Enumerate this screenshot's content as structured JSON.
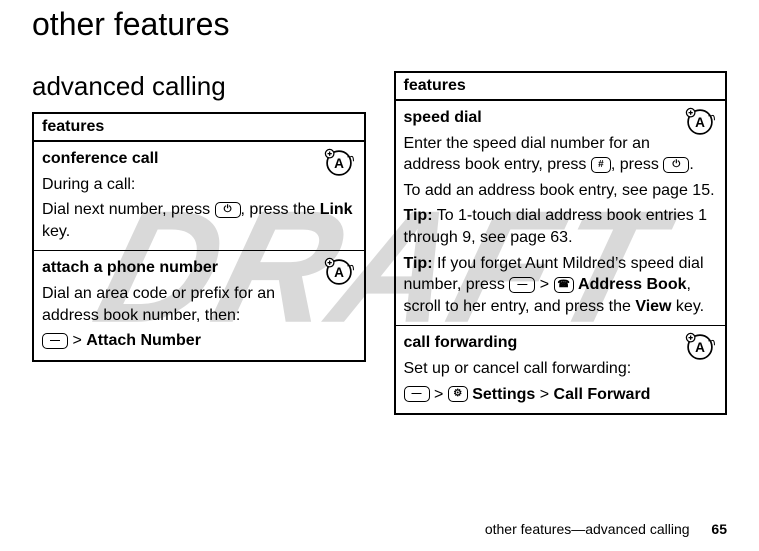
{
  "watermark": "DRAFT",
  "page_title": "other features",
  "section_title": "advanced calling",
  "left_table": {
    "header": "features",
    "rows": [
      {
        "title": "conference call",
        "line1": "During a call:",
        "line2a": "Dial next number, press ",
        "icon1": "send-icon",
        "line2b": ", press the ",
        "line2c": "Link",
        "line2d": " key."
      },
      {
        "title": "attach a phone number",
        "line1": "Dial an area code or prefix for an address book number, then:",
        "path_a": " > ",
        "path_b": "Attach Number"
      }
    ]
  },
  "right_table": {
    "header": "features",
    "rows": [
      {
        "title": "speed dial",
        "p1a": "Enter the speed dial number for an address book entry, press ",
        "key1": "#",
        "p1b": ", press ",
        "key2": "send-icon",
        "p1c": ".",
        "p2": "To add an address book entry, see page 15.",
        "tip1_label": "Tip:",
        "tip1_body": " To 1-touch dial address book entries 1 through 9, see page 63.",
        "tip2_label": "Tip:",
        "tip2_body_a": " If you forget Aunt Mildred’s speed dial number, press ",
        "tip2_sep1": " > ",
        "tip2_ab": "Address Book",
        "tip2_body_b": ", scroll to her entry, and press the ",
        "tip2_view": "View",
        "tip2_body_c": " key."
      },
      {
        "title": "call forwarding",
        "p1": "Set up or cancel call forwarding:",
        "path_sep1": " > ",
        "path_settings": "Settings",
        "path_sep2": " > ",
        "path_cf": "Call Forward"
      }
    ]
  },
  "footer_text": "other features—advanced calling",
  "page_number": "65"
}
